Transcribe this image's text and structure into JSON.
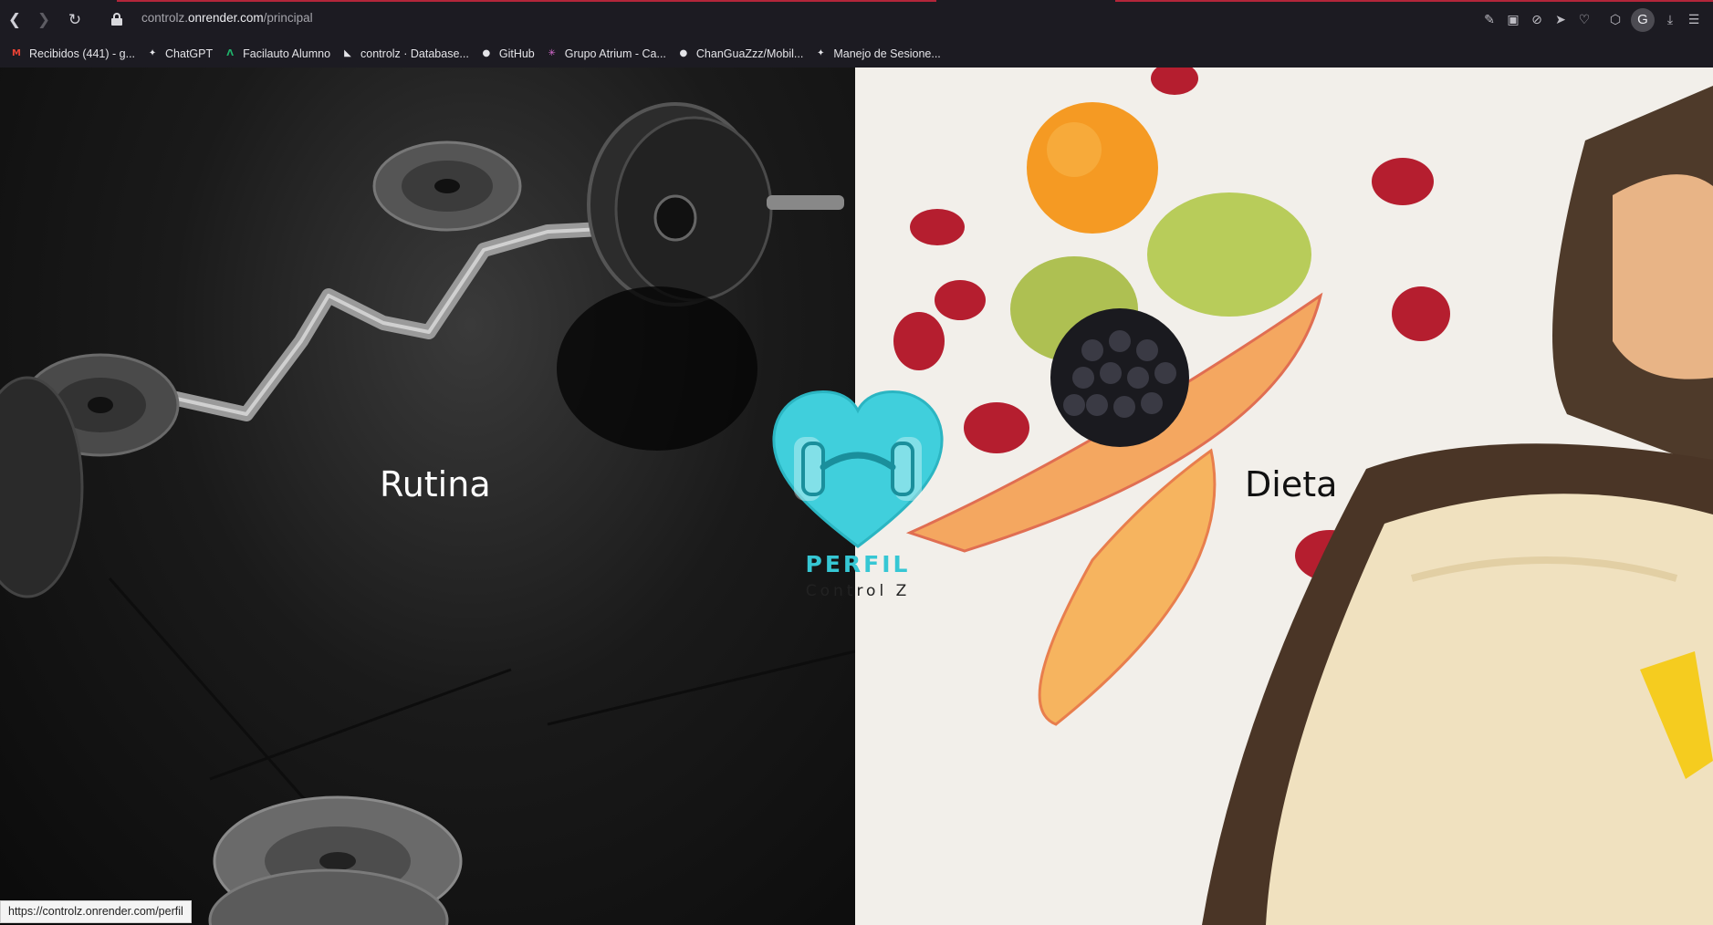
{
  "browser": {
    "url_prefix": "controlz.",
    "url_domain": "onrender.com",
    "url_path": "/principal",
    "profile_initial": "G",
    "nav_icons": [
      "back-icon",
      "forward-icon",
      "reload-icon",
      "lock-icon"
    ],
    "toolbar_icons": [
      "edit-icon",
      "screenshot-icon",
      "block-icon",
      "send-icon",
      "heart-icon",
      "cube-icon",
      "download-icon",
      "menu-icon"
    ]
  },
  "bookmarks": [
    {
      "label": "Recibidos (441) - g...",
      "icon": "gmail-icon",
      "color": "#ea4335"
    },
    {
      "label": "ChatGPT",
      "icon": "chatgpt-icon",
      "color": "#e4e4e8"
    },
    {
      "label": "Facilauto Alumno",
      "icon": "facilauto-icon",
      "color": "#1fb36b"
    },
    {
      "label": "controlz · Database...",
      "icon": "render-icon",
      "color": "#e4e4e8"
    },
    {
      "label": "GitHub",
      "icon": "github-icon",
      "color": "#e4e4e8"
    },
    {
      "label": "Grupo Atrium - Ca...",
      "icon": "atrium-icon",
      "color": "#d86bd1"
    },
    {
      "label": "ChanGuaZzz/Mobil...",
      "icon": "github-icon",
      "color": "#e4e4e8"
    },
    {
      "label": "Manejo de Sesione...",
      "icon": "chatgpt-icon",
      "color": "#e4e4e8"
    }
  ],
  "main": {
    "left_label": "Rutina",
    "right_label": "Dieta",
    "logo_title": "PERFIL",
    "logo_subtitle": "Control Z"
  },
  "status_bar": {
    "link_preview": "https://controlz.onrender.com/perfil"
  },
  "colors": {
    "accent": "#36c7d4",
    "chrome_bg": "#1c1b22"
  }
}
